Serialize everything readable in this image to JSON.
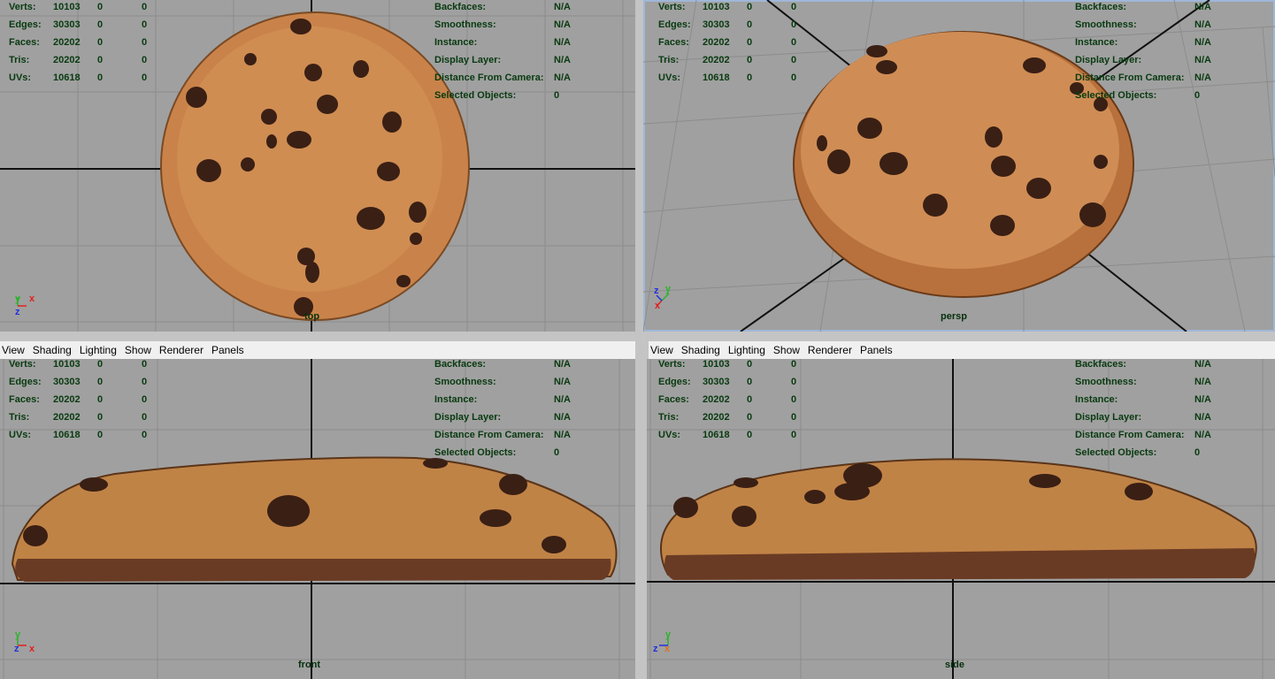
{
  "menu": [
    "View",
    "Shading",
    "Lighting",
    "Show",
    "Renderer",
    "Panels"
  ],
  "hud_left": {
    "rows": [
      {
        "label": "Verts:",
        "v1": "10103",
        "v2": "0",
        "v3": "0"
      },
      {
        "label": "Edges:",
        "v1": "30303",
        "v2": "0",
        "v3": "0"
      },
      {
        "label": "Faces:",
        "v1": "20202",
        "v2": "0",
        "v3": "0"
      },
      {
        "label": "Tris:",
        "v1": "20202",
        "v2": "0",
        "v3": "0"
      },
      {
        "label": "UVs:",
        "v1": "10618",
        "v2": "0",
        "v3": "0"
      }
    ]
  },
  "hud_right": {
    "rows": [
      {
        "label": "Backfaces:",
        "value": "N/A"
      },
      {
        "label": "Smoothness:",
        "value": "N/A"
      },
      {
        "label": "Instance:",
        "value": "N/A"
      },
      {
        "label": "Display Layer:",
        "value": "N/A"
      },
      {
        "label": "Distance From Camera:",
        "value": "N/A"
      },
      {
        "label": "Selected Objects:",
        "value": "0"
      }
    ]
  },
  "panels": {
    "top": {
      "label": "top"
    },
    "persp": {
      "label": "persp"
    },
    "front": {
      "label": "front"
    },
    "side": {
      "label": "side"
    }
  },
  "axes": {
    "x": "x",
    "y": "y",
    "z": "z"
  },
  "colors": {
    "viewport_bg": "#a0a0a0",
    "hud_text": "#083a10",
    "grid_line": "#8c8c8c",
    "axis_line": "#111111",
    "cookie": "#c9834a",
    "chip": "#3a1f14",
    "active_border": "#9fb7d8"
  }
}
